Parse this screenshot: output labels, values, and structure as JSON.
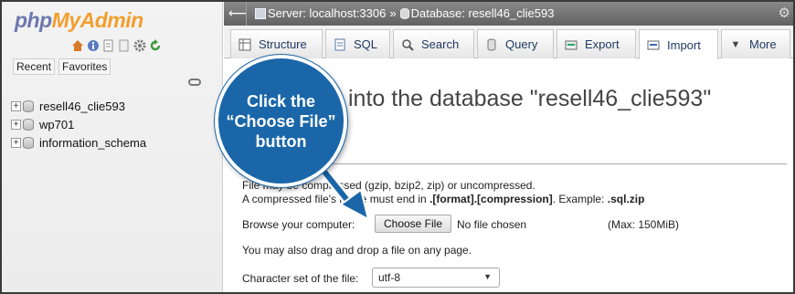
{
  "nav": {
    "logo_php": "php",
    "logo_myadmin": "MyAdmin",
    "icons": [
      "home-icon",
      "info-icon",
      "docs-icon",
      "gear-icon",
      "reload-icon"
    ],
    "tabs": [
      "Recent",
      "Favorites"
    ],
    "databases": [
      "resell46_clie593",
      "wp701",
      "information_schema"
    ]
  },
  "topbar": {
    "server": "Server: localhost:3306",
    "separator": "»",
    "database": "Database: resell46_clie593"
  },
  "tabs": [
    {
      "label": "Structure",
      "icon": "structure-icon"
    },
    {
      "label": "SQL",
      "icon": "sql-icon"
    },
    {
      "label": "Search",
      "icon": "search-icon"
    },
    {
      "label": "Query",
      "icon": "query-icon"
    },
    {
      "label": "Export",
      "icon": "export-icon"
    },
    {
      "label": "Import",
      "icon": "import-icon",
      "active": true
    },
    {
      "label": "More",
      "icon": "chevron-down-icon"
    }
  ],
  "main": {
    "title_partial": "into the database \"resell46_clie593\"",
    "line1": "File may be compressed (gzip, bzip2, zip) or uncompressed.",
    "line2_prefix": "A compressed file's name must end in ",
    "line2_bold1": ".[format].[compression]",
    "line2_mid": ". Example: ",
    "line2_bold2": ".sql.zip",
    "browse_label": "Browse your computer:",
    "choose_file": "Choose File",
    "no_file": "No file chosen",
    "max_size": "(Max: 150MiB)",
    "drag_text": "You may also drag and drop a file on any page.",
    "charset_label": "Character set of the file:",
    "charset_value": "utf-8"
  },
  "callout": {
    "line1": "Click the",
    "line2": "“Choose File”",
    "line3": "button",
    "color": "#1a66a8"
  }
}
